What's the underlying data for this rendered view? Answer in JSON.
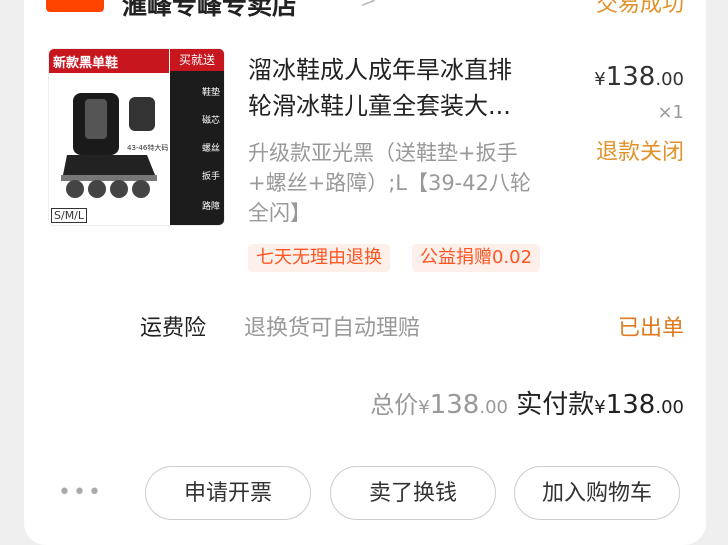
{
  "shop": {
    "name": "滙峰专峰专卖店",
    "trade_status": "交易成功"
  },
  "product": {
    "thumb": {
      "title": "新款黑单鞋",
      "side_title": "买就送",
      "side_items": [
        "鞋垫",
        "磁芯",
        "螺丝",
        "扳手",
        "路障"
      ],
      "size_label": "S/M/L",
      "note": "43-46特大码"
    },
    "title_lines": [
      "溜冰鞋成人成年旱冰直排",
      "轮滑冰鞋儿童全套装大..."
    ],
    "price": {
      "currency": "¥",
      "integer": "138",
      "decimal": ".00"
    },
    "quantity": "×1",
    "refund_status": "退款关闭",
    "spec_lines": [
      "升级款亚光黑（送鞋垫+扳手",
      "+螺丝+路障）;L【39-42八轮",
      "全闪】"
    ],
    "tags": [
      "七天无理由退换",
      "公益捐赠0.02"
    ]
  },
  "insurance": {
    "label": "运费险",
    "desc": "退换货可自动理赔",
    "status": "已出单"
  },
  "totals": {
    "total_label": "总价",
    "total_currency": "¥",
    "total_integer": "138",
    "total_decimal": ".00",
    "paid_label": "实付款",
    "paid_currency": "¥",
    "paid_integer": "138",
    "paid_decimal": ".00"
  },
  "actions": {
    "more": "•••",
    "invoice": "申请开票",
    "resell": "卖了换钱",
    "add_cart": "加入购物车"
  },
  "colors": {
    "accent_orange": "#e0922b",
    "tag_red": "#ff5522",
    "badge_red": "#ff4400"
  }
}
